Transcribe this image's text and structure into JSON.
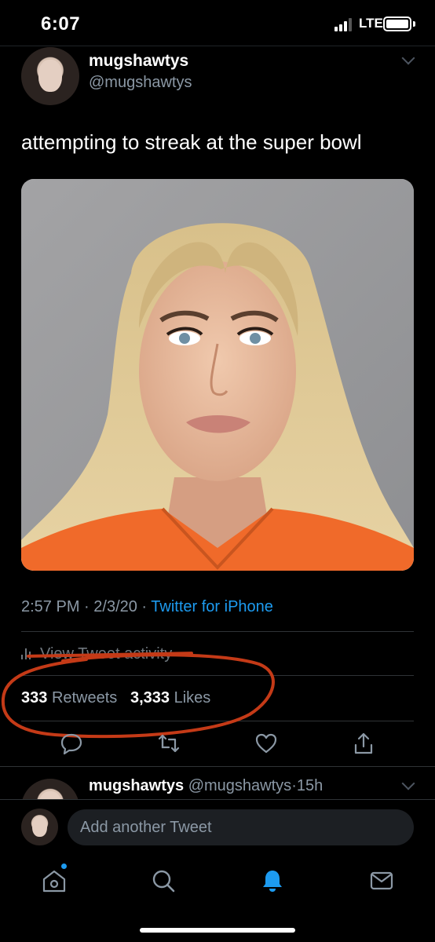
{
  "status_bar": {
    "time": "6:07",
    "network": "LTE"
  },
  "tweet": {
    "display_name": "mugshawtys",
    "handle": "@mugshawtys",
    "text": "attempting to streak at the super bowl",
    "time": "2:57 PM",
    "date": "2/3/20",
    "source": "Twitter for iPhone",
    "activity_label": "View Tweet activity",
    "retweets_count": "333",
    "retweets_label": "Retweets",
    "likes_count": "3,333",
    "likes_label": "Likes",
    "actions": [
      "reply-icon",
      "retweet-icon",
      "like-icon",
      "share-icon"
    ]
  },
  "reply": {
    "display_name": "mugshawtys",
    "handle": "@mugshawtys",
    "age": "15h"
  },
  "compose": {
    "placeholder": "Add another Tweet"
  },
  "tab_bar": {
    "tabs": [
      "home-icon",
      "search-icon",
      "notifications-icon",
      "messages-icon"
    ],
    "active_tab": "notifications-icon"
  },
  "colors": {
    "background": "#000000",
    "accent": "#1d9bf0",
    "secondary_text": "#8b98a5",
    "annotation": "#c43a17"
  }
}
